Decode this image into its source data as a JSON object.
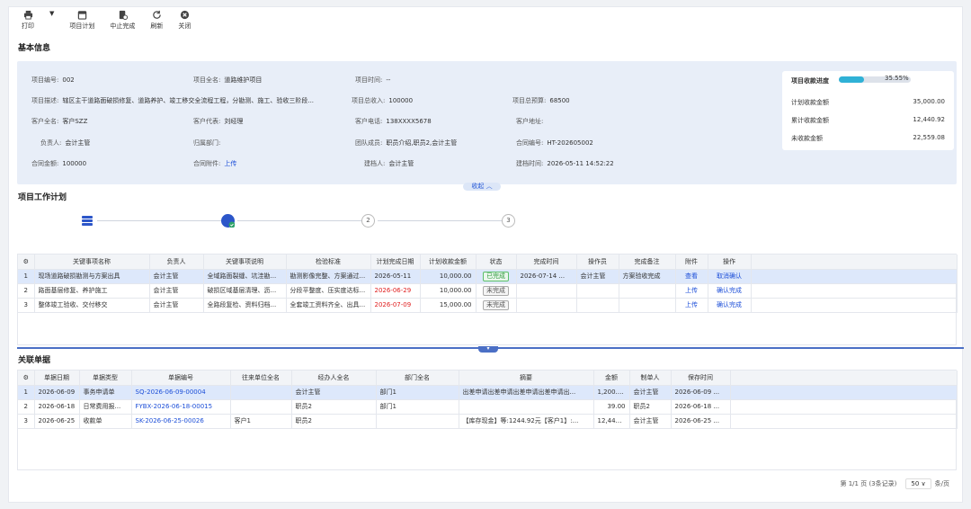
{
  "toolbar": {
    "print": "打印",
    "plan": "项目计划",
    "stop": "中止完成",
    "refresh": "刷新",
    "close": "关闭"
  },
  "basic_title": "基本信息",
  "info": {
    "r1": [
      {
        "k": "项目编号:",
        "v": "002"
      },
      {
        "k": "项目全名:",
        "v": "道路维护项目"
      },
      {
        "k": "项目时间:",
        "v": "--"
      }
    ],
    "r2": [
      {
        "k": "项目描述:",
        "v": "辖区主干道路面破损修复、道路养护、竣工移交全流程工程，分勘测、施工、验收三阶段..."
      },
      {
        "k": "项目总收入:",
        "v": "100000"
      },
      {
        "k": "项目总预算:",
        "v": "68500"
      }
    ],
    "r3": [
      {
        "k": "客户全名:",
        "v": "客户SZZ"
      },
      {
        "k": "客户代表:",
        "v": "刘经理"
      },
      {
        "k": "客户电话:",
        "v": "138XXXX5678"
      },
      {
        "k": "客户地址:",
        "v": ""
      }
    ],
    "r4": [
      {
        "k": "负责人:",
        "v": "会计主管"
      },
      {
        "k": "归属部门:",
        "v": ""
      },
      {
        "k": "团队成员:",
        "v": "职员介绍,职员2,会计主管"
      },
      {
        "k": "合同编号:",
        "v": "HT-202605002"
      }
    ],
    "r5": [
      {
        "k": "合同金额:",
        "v": "100000"
      },
      {
        "k": "合同附件:",
        "v": "上传"
      },
      {
        "k": "建档人:",
        "v": "会计主管"
      },
      {
        "k": "建档时间:",
        "v": "2026-05-11 14:52:22"
      }
    ]
  },
  "progress": {
    "title": "项目收款进度",
    "percent_text": "35.55%",
    "percent": 35.55,
    "rows": [
      {
        "k": "计划收款金额",
        "v": "35,000.00"
      },
      {
        "k": "累计收款金额",
        "v": "12,440.92"
      },
      {
        "k": "未收款金额",
        "v": "22,559.08"
      }
    ]
  },
  "collapse_label": "收起 ︿",
  "plan_title": "项目工作计划",
  "steps": [
    "2",
    "3"
  ],
  "plan_table": {
    "headers": [
      "关键事项名称",
      "负责人",
      "关键事项说明",
      "检验标准",
      "计划完成日期",
      "计划收款金额",
      "状态",
      "完成时间",
      "操作员",
      "完成备注",
      "附件",
      "操作"
    ],
    "rows": [
      {
        "idx": "1",
        "name": "现场道路破损勘测与方案出具",
        "owner": "会计主管",
        "desc": "全域路面裂缝、坑洼勘...",
        "std": "勘测影像完整、方案通过...",
        "date": "2026-05-11",
        "amount": "10,000.00",
        "status": "已完成",
        "ftime": "2026-07-14 ...",
        "op": "会计主管",
        "note": "方案验收完成",
        "att": "查看",
        "action": "取消确认"
      },
      {
        "idx": "2",
        "name": "路面基层修复、养护施工",
        "owner": "会计主管",
        "desc": "破损区域基层清理、沥...",
        "std": "分段平整度、压实度达标...",
        "date": "2026-06-29",
        "amount": "10,000.00",
        "status": "未完成",
        "ftime": "",
        "op": "",
        "note": "",
        "att": "上传",
        "action": "确认完成"
      },
      {
        "idx": "3",
        "name": "整体竣工验收、交付移交",
        "owner": "会计主管",
        "desc": "全路段复检、资料归档...",
        "std": "全套竣工资料齐全、出具...",
        "date": "2026-07-09",
        "amount": "15,000.00",
        "status": "未完成",
        "ftime": "",
        "op": "",
        "note": "",
        "att": "上传",
        "action": "确认完成"
      }
    ]
  },
  "related_title": "关联单据",
  "rel_table": {
    "headers": [
      "单据日期",
      "单据类型",
      "单据编号",
      "往来单位全名",
      "经办人全名",
      "部门全名",
      "摘要",
      "金额",
      "制单人",
      "保存时间"
    ],
    "rows": [
      {
        "idx": "1",
        "date": "2026-06-09",
        "type": "事务申请单",
        "no": "SQ-2026-06-09-00004",
        "unit": "",
        "handler": "会计主管",
        "dept": "部门1",
        "summary": "出差申请出差申请出差申请出差申请出...",
        "amount": "1,200.00",
        "maker": "会计主管",
        "saved": "2026-06-09 ..."
      },
      {
        "idx": "2",
        "date": "2026-06-18",
        "type": "日常费用报...",
        "no": "FYBX-2026-06-18-00015",
        "unit": "",
        "handler": "职员2",
        "dept": "部门1",
        "summary": "",
        "amount": "39.00",
        "maker": "职员2",
        "saved": "2026-06-18 ..."
      },
      {
        "idx": "3",
        "date": "2026-06-25",
        "type": "收款单",
        "no": "SK-2026-06-25-00026",
        "unit": "客户1",
        "handler": "职员2",
        "dept": "",
        "summary": "【库存现金】等:1244.92元【客户1】:...",
        "amount": "12,440.92",
        "maker": "会计主管",
        "saved": "2026-06-25 ..."
      }
    ]
  },
  "pager": {
    "info": "第 1/1 页 (3条记录)",
    "size": "50",
    "unit": "条/页"
  },
  "colors": {
    "accent": "#2c56c9",
    "overdue": "#e02020",
    "link": "#1d4fd8",
    "progress": "#2fb1d6"
  }
}
